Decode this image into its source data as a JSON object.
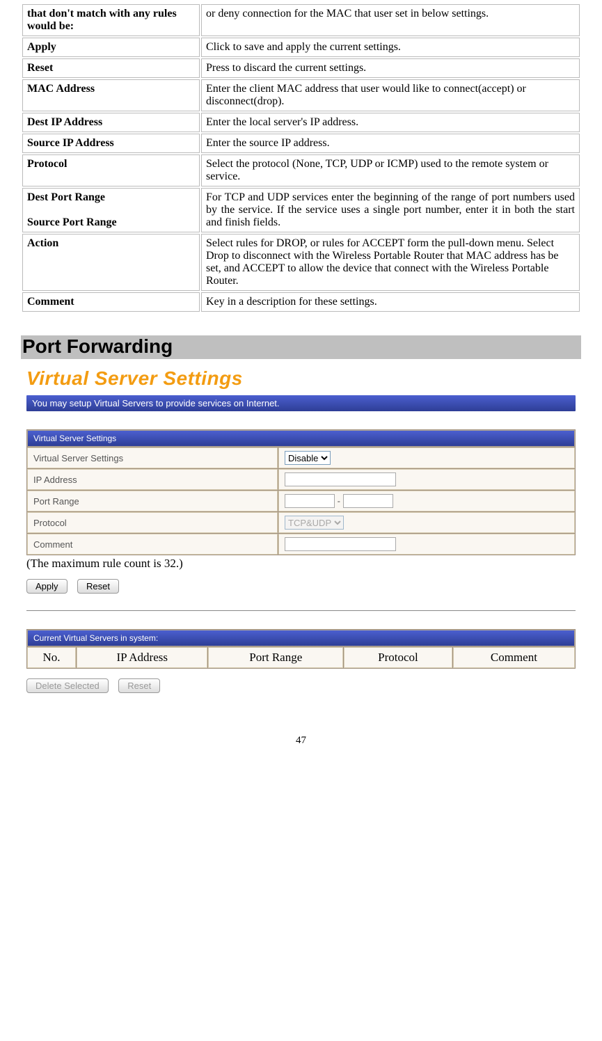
{
  "param_table": [
    {
      "label": "that don't match with any rules would be:",
      "desc": "or deny connection for the MAC that user set in below settings."
    },
    {
      "label": "Apply",
      "desc": "Click to save and apply the current settings."
    },
    {
      "label": "Reset",
      "desc": "Press to discard the current settings."
    },
    {
      "label": "MAC Address",
      "desc": "Enter the client MAC address that user would like to connect(accept) or disconnect(drop)."
    },
    {
      "label": "Dest IP Address",
      "desc": "Enter the local server's IP address."
    },
    {
      "label": "Source IP Address",
      "desc": "Enter the source IP address."
    },
    {
      "label": "Protocol",
      "desc": "Select the protocol (None, TCP, UDP or ICMP) used to the remote system or service."
    },
    {
      "label": "Dest Port Range\n\nSource Port Range",
      "desc": "For TCP and UDP services enter the beginning of the range of port numbers used by the service. If the service uses a single port number, enter it in both the start and finish fields."
    },
    {
      "label": "Action",
      "desc": "Select rules for DROP, or rules for ACCEPT form the pull-down menu. Select Drop to disconnect with the Wireless Portable Router that MAC address has be set, and ACCEPT to allow the device that connect with the Wireless Portable Router."
    },
    {
      "label": "Comment",
      "desc": "Key in a description for these settings."
    }
  ],
  "section_heading": "Port Forwarding",
  "vs": {
    "title": "Virtual Server Settings",
    "info": "You may setup Virtual Servers to provide services on Internet.",
    "form_header": "Virtual Server Settings",
    "rows": {
      "vss_label": "Virtual Server Settings",
      "vss_value": "Disable",
      "ip_label": "IP Address",
      "port_label": "Port Range",
      "port_dash": "-",
      "proto_label": "Protocol",
      "proto_value": "TCP&UDP",
      "comment_label": "Comment"
    },
    "note": "(The maximum rule count is 32.)",
    "apply_btn": "Apply",
    "reset_btn": "Reset",
    "current_header": "Current Virtual Servers in system:",
    "cols": [
      "No.",
      "IP Address",
      "Port Range",
      "Protocol",
      "Comment"
    ],
    "delete_btn": "Delete Selected",
    "reset2_btn": "Reset"
  },
  "page_number": "47"
}
